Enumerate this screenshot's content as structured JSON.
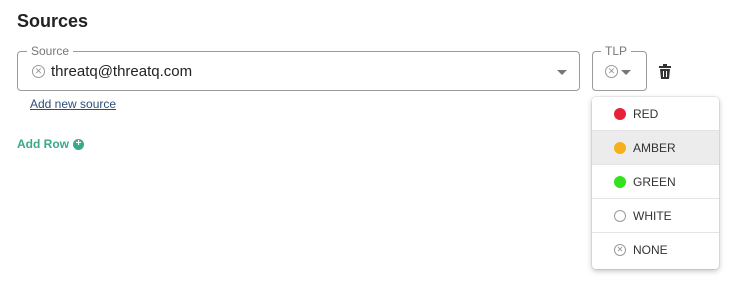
{
  "section_title": "Sources",
  "source_field": {
    "label": "Source",
    "value": "threatq@threatq.com"
  },
  "tlp_field": {
    "label": "TLP"
  },
  "add_source_link": "Add new source",
  "add_row_button": "Add Row",
  "tlp_options": [
    {
      "label": "RED",
      "color": "#e8213b"
    },
    {
      "label": "AMBER",
      "color": "#f5b01a"
    },
    {
      "label": "GREEN",
      "color": "#33e21d"
    },
    {
      "label": "WHITE",
      "color": "#ffffff"
    },
    {
      "label": "NONE",
      "color": ""
    }
  ],
  "icons": {
    "clear": "circle-x-icon",
    "dropdown": "chevron-down-icon",
    "delete": "trash-icon",
    "add": "plus-circle-icon"
  }
}
